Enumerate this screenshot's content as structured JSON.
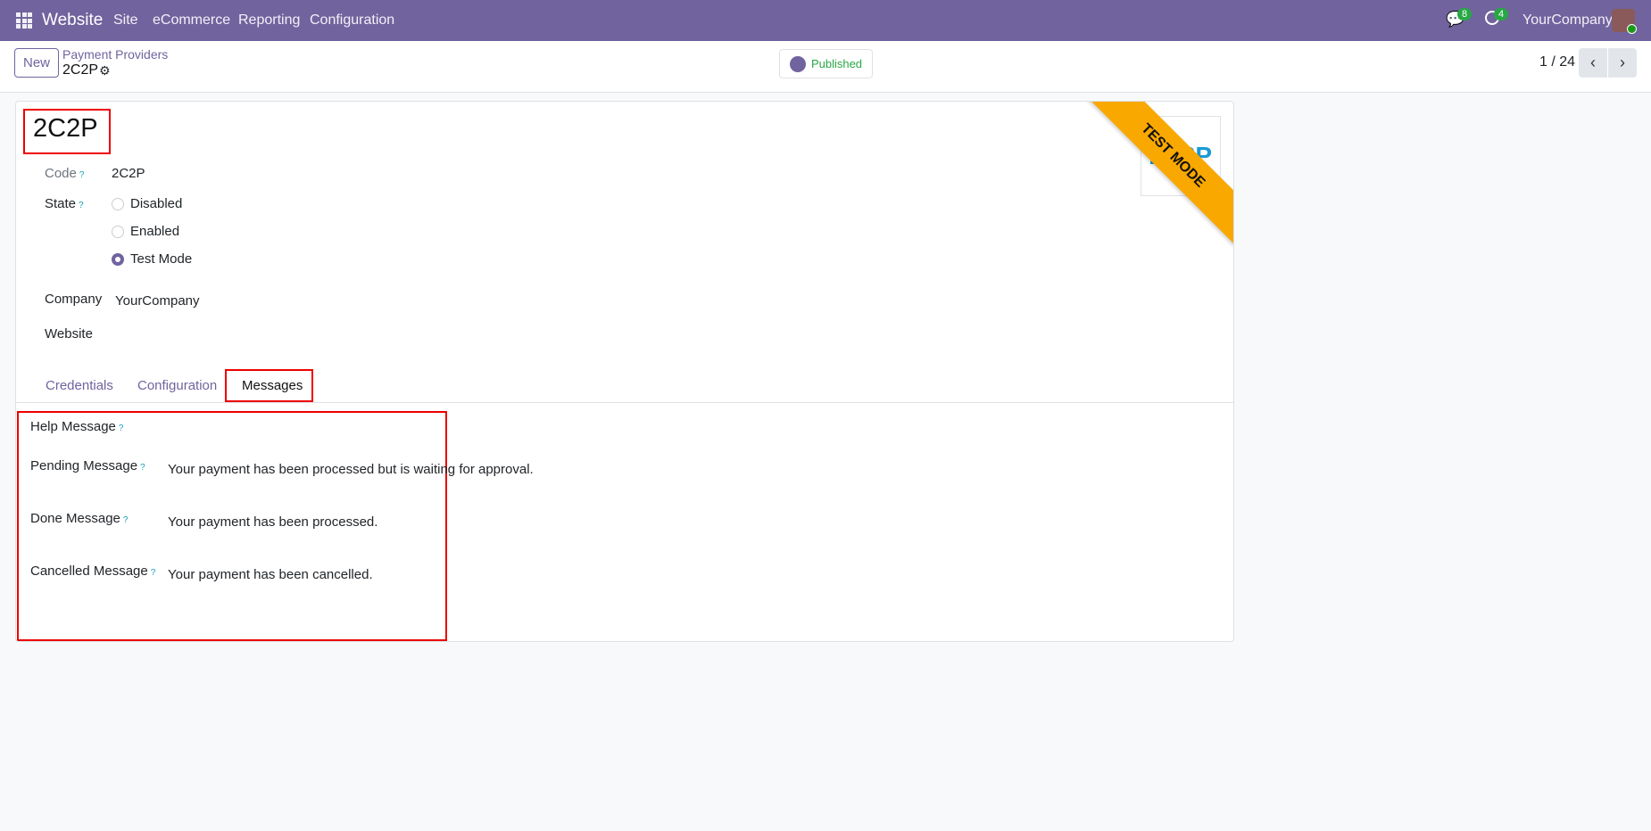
{
  "navbar": {
    "app": "Website",
    "menus": [
      "Site",
      "eCommerce",
      "Reporting",
      "Configuration"
    ],
    "messages_count": "8",
    "activities_count": "4",
    "company": "YourCompany"
  },
  "control": {
    "new_label": "New",
    "breadcrumb_parent": "Payment Providers",
    "breadcrumb_current": "2C2P",
    "published_label": "Published",
    "pager": "1 / 24"
  },
  "form": {
    "title": "2C2P",
    "ribbon": "TEST MODE",
    "logo_text": "2C2P",
    "code_label": "Code",
    "code_value": "2C2P",
    "state_label": "State",
    "states": [
      "Disabled",
      "Enabled",
      "Test Mode"
    ],
    "selected_state": "Test Mode",
    "company_label": "Company",
    "company_value": "YourCompany",
    "website_label": "Website",
    "tabs": [
      "Credentials",
      "Configuration",
      "Messages"
    ],
    "active_tab": "Messages",
    "messages": {
      "help_label": "Help Message",
      "pending_label": "Pending Message",
      "pending_value": "Your payment has been processed but is waiting for approval.",
      "done_label": "Done Message",
      "done_value": "Your payment has been processed.",
      "cancelled_label": "Cancelled Message",
      "cancelled_value": "Your payment has been cancelled."
    }
  },
  "colors": {
    "brand": "#71639e",
    "ribbon": "#f9a800",
    "highlight": "#ee0000",
    "badge": "#28a745"
  }
}
